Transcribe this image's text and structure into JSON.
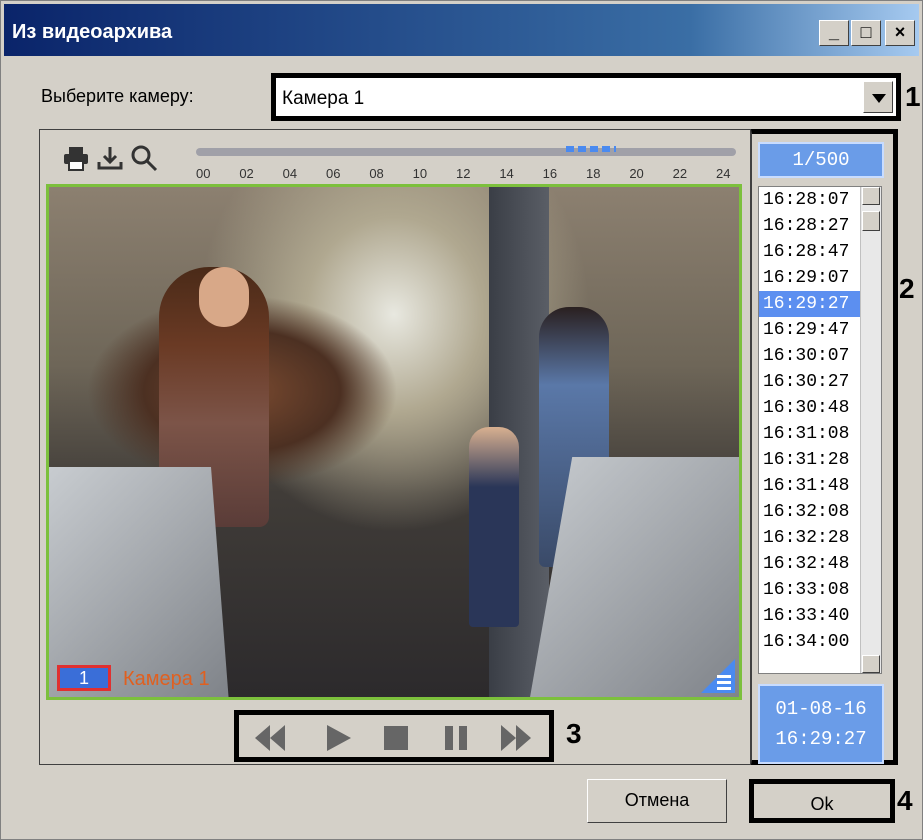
{
  "window": {
    "title": "Из видеоархива",
    "controls": {
      "minimize": "_",
      "maximize": "□",
      "close": "×"
    }
  },
  "camera_select": {
    "label": "Выберите камеру:",
    "value": "Камера 1"
  },
  "callouts": {
    "one": "1",
    "two": "2",
    "three": "3",
    "four": "4"
  },
  "toolbar": {
    "icons": [
      "printer-icon",
      "download-icon",
      "magnifier-icon"
    ],
    "timeline_ticks": [
      "00",
      "02",
      "04",
      "06",
      "08",
      "10",
      "12",
      "14",
      "16",
      "18",
      "20",
      "22",
      "24"
    ]
  },
  "video": {
    "camera_id": "1",
    "camera_name": "Камера 1"
  },
  "playback": {
    "buttons": [
      "rewind",
      "play",
      "stop",
      "pause",
      "fast-forward"
    ]
  },
  "archive": {
    "counter": "1/500",
    "times": [
      "16:28:07",
      "16:28:27",
      "16:28:47",
      "16:29:07",
      "16:29:27",
      "16:29:47",
      "16:30:07",
      "16:30:27",
      "16:30:48",
      "16:31:08",
      "16:31:28",
      "16:31:48",
      "16:32:08",
      "16:32:28",
      "16:32:48",
      "16:33:08",
      "16:33:40",
      "16:34:00"
    ],
    "selected_index": 4,
    "date": "01-08-16",
    "time": "16:29:27"
  },
  "footer": {
    "cancel": "Отмена",
    "ok": "Ok"
  },
  "colors": {
    "accent": "#5c8ff0",
    "video_border": "#7cc03c",
    "cam_name": "#e06020"
  }
}
